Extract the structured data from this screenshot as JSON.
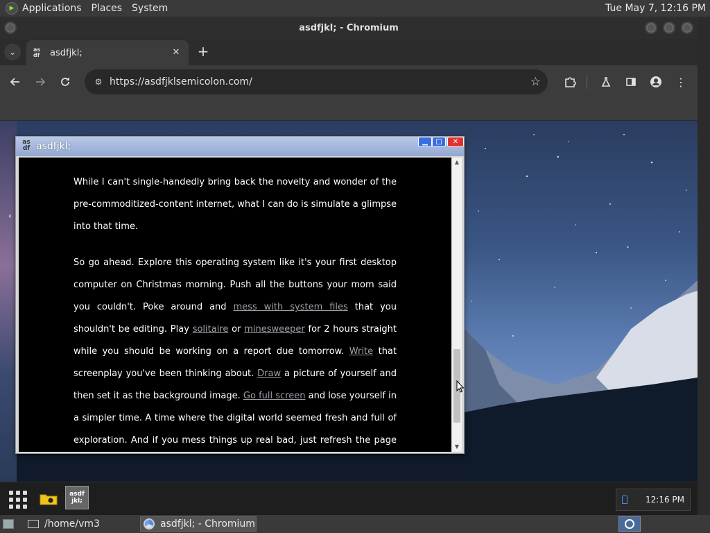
{
  "top_panel": {
    "menus": [
      "Applications",
      "Places",
      "System"
    ],
    "clock": "Tue May  7, 12:16 PM"
  },
  "chromium": {
    "window_title": "asdfjkl; - Chromium",
    "tab": {
      "title": "asdfjkl;",
      "favicon_text": "as df"
    },
    "url": "https://asdfjklsemicolon.com/"
  },
  "app_window": {
    "title": "asdfjkl;",
    "paragraph1": "While I can't single-handedly bring back the novelty and wonder of the pre-commoditized-content internet, what I can do is simulate a glimpse into that time.",
    "p2": {
      "t1": "So go ahead. Explore this operating system like it's your first desktop computer on Christmas morning. Push all the buttons your mom said you couldn't. Poke around and ",
      "link_system_files": "mess with system files",
      "t2": " that you shouldn't be editing. Play ",
      "link_solitaire": "solitaire",
      "t3": " or ",
      "link_minesweeper": "minesweeper",
      "t4": " for 2 hours straight while you should be working on a report due tomorrow. ",
      "link_write": "Write",
      "t5": " that screenplay you've been thinking about. ",
      "link_draw": "Draw",
      "t6": " a picture of yourself and then set it as the background image. ",
      "link_fullscreen": "Go full screen",
      "t7": " and lose yourself in a simpler time. A time where the digital world seemed fresh and full of exploration. And if you mess things up real bad, just refresh the page and start over."
    }
  },
  "page_taskbar": {
    "asdf_label": "asdf jkl;",
    "tray_time": "12:16 PM"
  },
  "bottom_panel": {
    "task_terminal": "/home/vm3",
    "task_chromium": "asdfjkl; - Chromium"
  }
}
